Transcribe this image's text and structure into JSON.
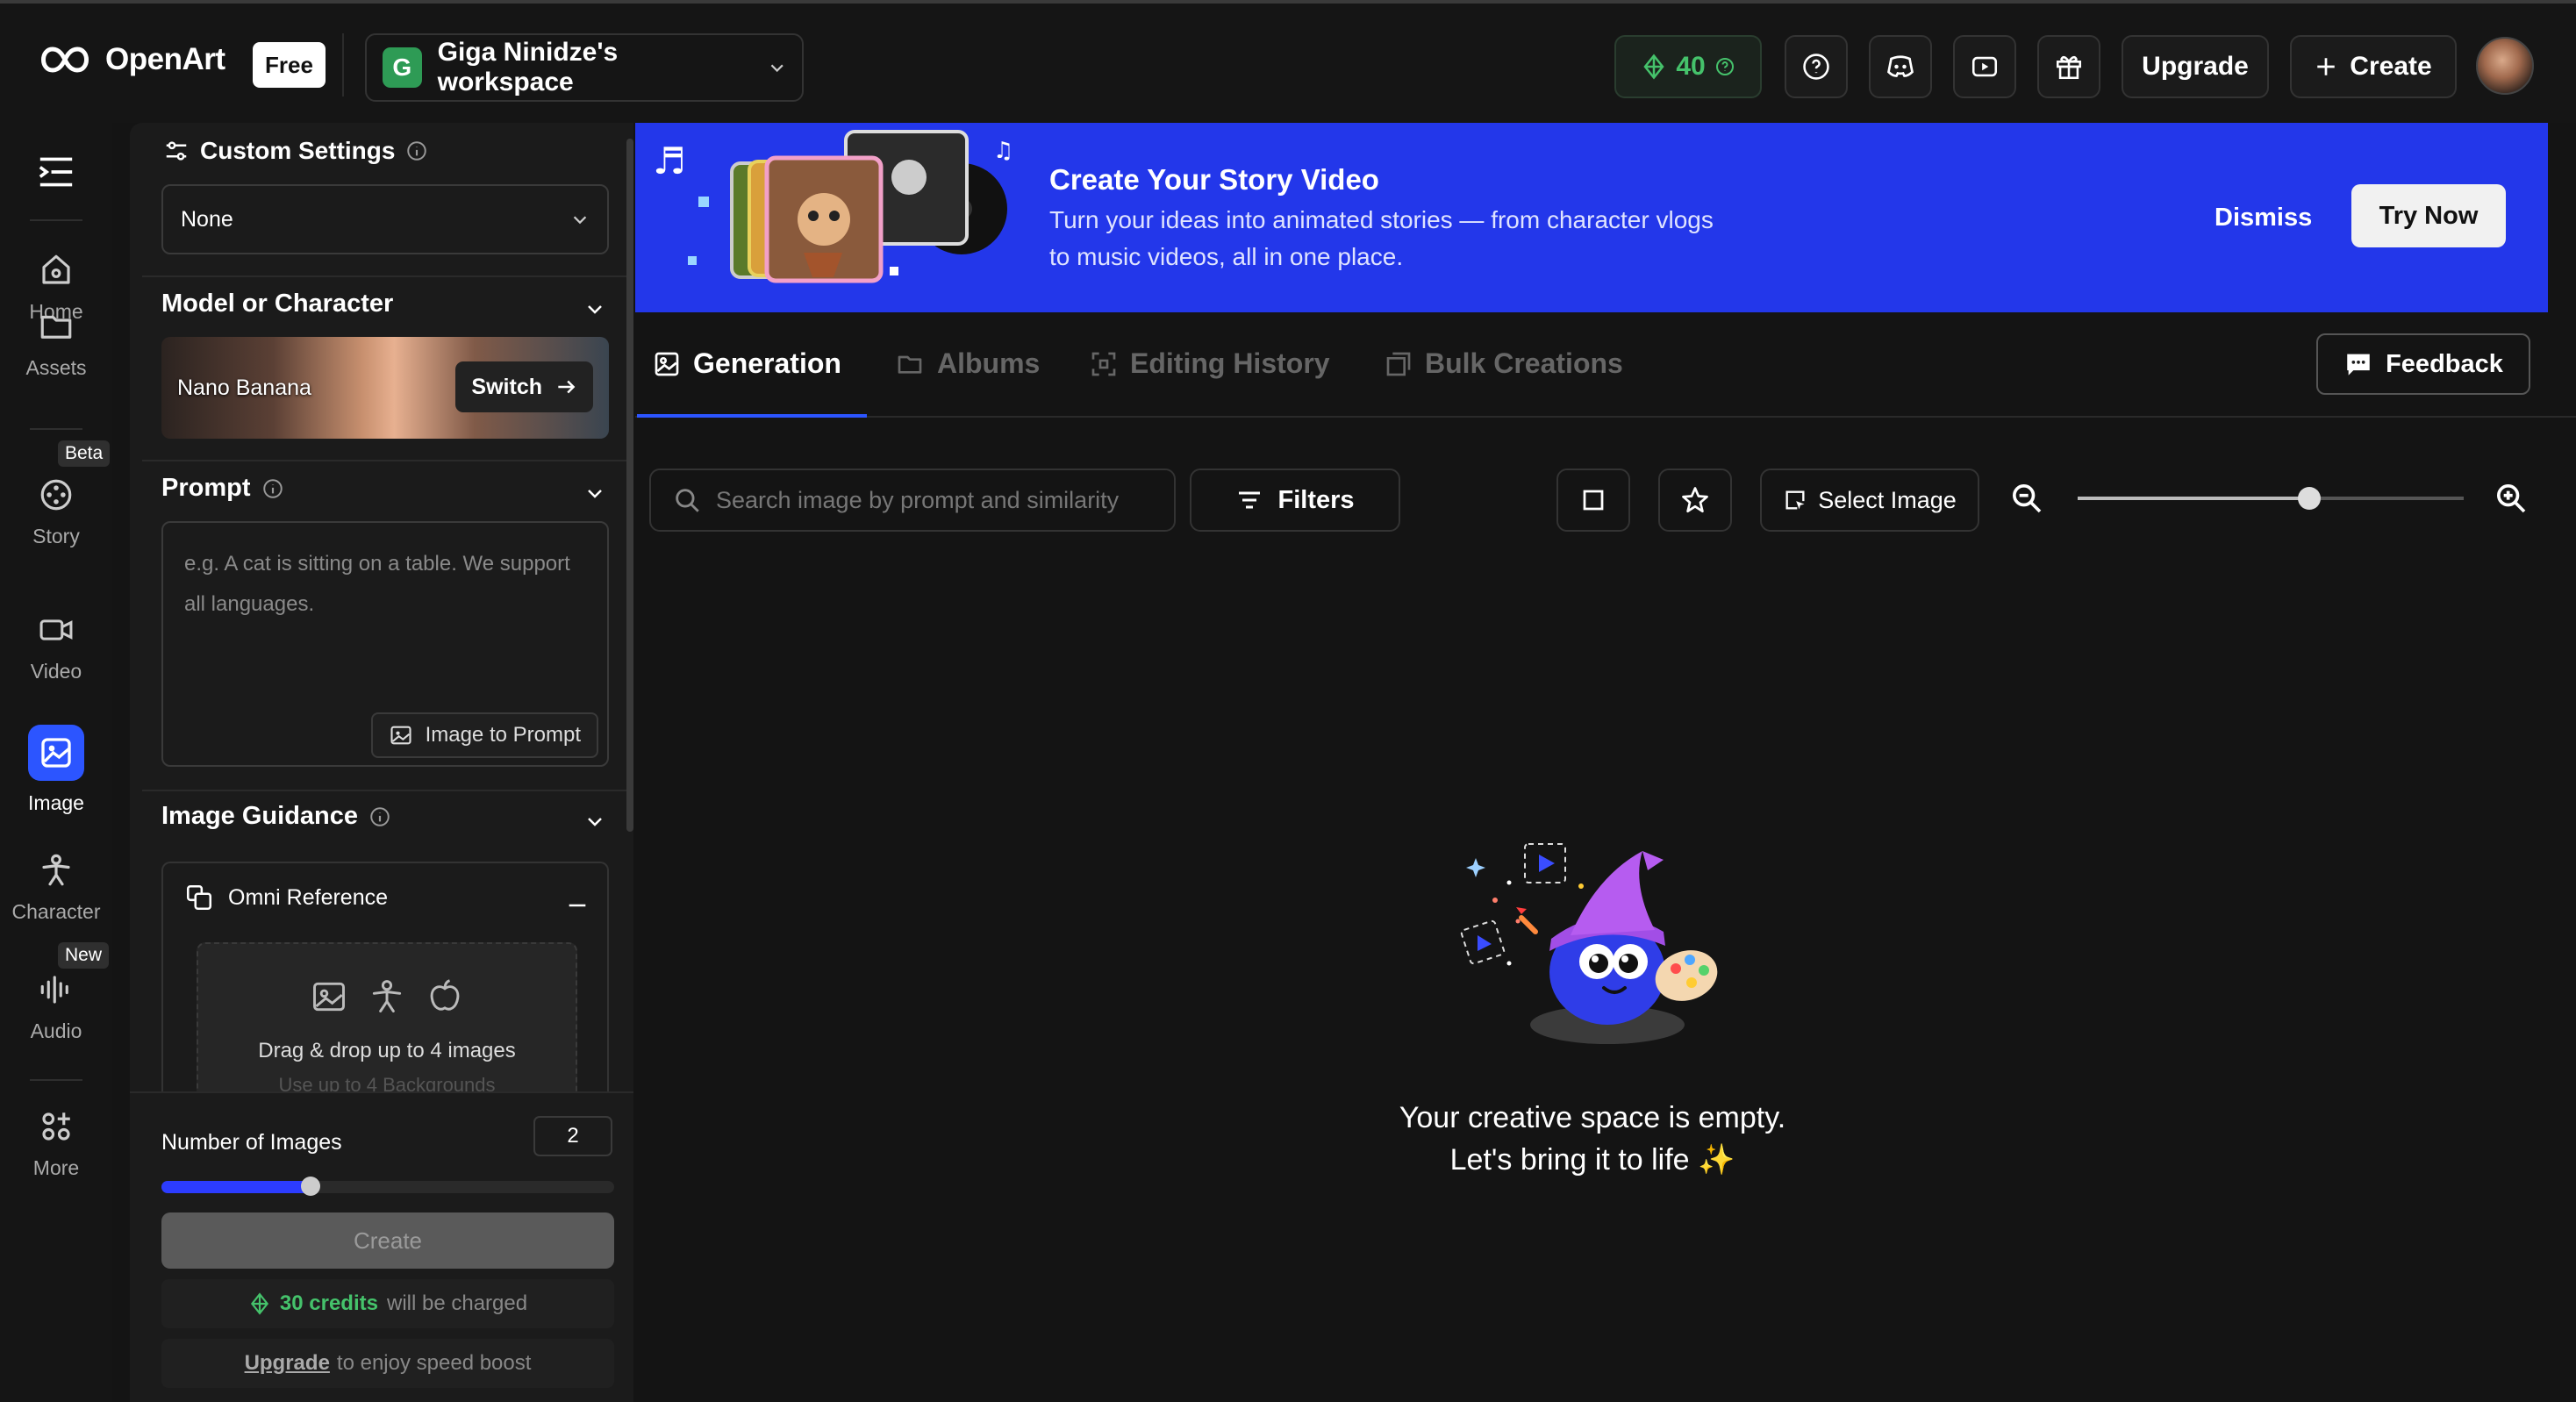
{
  "header": {
    "brand": "OpenArt",
    "plan_badge": "Free",
    "workspace_initial": "G",
    "workspace_name": "Giga Ninidze's workspace",
    "credits": "40",
    "upgrade_label": "Upgrade",
    "create_label": "Create"
  },
  "sidebar": {
    "items": [
      {
        "label": "Home",
        "icon": "home-icon"
      },
      {
        "label": "Assets",
        "icon": "folder-icon"
      },
      {
        "label": "Story",
        "icon": "film-reel-icon",
        "badge": "Beta"
      },
      {
        "label": "Video",
        "icon": "video-camera-icon"
      },
      {
        "label": "Image",
        "icon": "image-icon",
        "active": true
      },
      {
        "label": "Character",
        "icon": "character-icon"
      },
      {
        "label": "Audio",
        "icon": "audio-wave-icon",
        "badge": "New"
      },
      {
        "label": "More",
        "icon": "apps-icon"
      }
    ]
  },
  "panel": {
    "custom_settings_title": "Custom Settings",
    "custom_settings_value": "None",
    "model_title": "Model or Character",
    "model_name": "Nano Banana",
    "switch_label": "Switch",
    "prompt_title": "Prompt",
    "prompt_placeholder": "e.g. A cat is sitting on a table. We support all languages.",
    "image_to_prompt_label": "Image to Prompt",
    "image_guidance_title": "Image Guidance",
    "omni_reference_label": "Omni Reference",
    "dropzone_text": "Drag & drop up to 4 images",
    "dropzone_subtext": "Use up to 4 Backgrounds",
    "number_of_images_label": "Number of Images",
    "number_of_images_value": "2",
    "number_of_images_fraction": 0.33,
    "create_label": "Create",
    "credits_charge_bold": "30 credits",
    "credits_charge_rest": "will be charged",
    "upgrade_link": "Upgrade",
    "upgrade_rest": "to enjoy speed boost"
  },
  "banner": {
    "title": "Create Your Story Video",
    "description": "Turn your ideas into animated stories — from character vlogs to music videos, all in one place.",
    "dismiss_label": "Dismiss",
    "try_now_label": "Try Now"
  },
  "tabs": [
    {
      "label": "Generation",
      "active": true
    },
    {
      "label": "Albums"
    },
    {
      "label": "Editing History"
    },
    {
      "label": "Bulk Creations"
    }
  ],
  "feedback_label": "Feedback",
  "toolbar": {
    "search_placeholder": "Search image by prompt and similarity",
    "filters_label": "Filters",
    "select_image_label": "Select Image",
    "zoom_fraction": 0.6
  },
  "empty_state": {
    "line1": "Your creative space is empty.",
    "line2": "Let's bring it to life ✨"
  },
  "colors": {
    "accent": "#2c55ff",
    "banner_bg": "#2337ea",
    "credits_green": "#45c26b"
  }
}
